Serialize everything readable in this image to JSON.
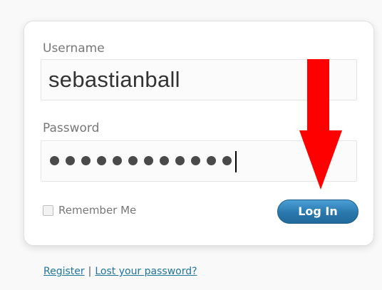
{
  "login_form": {
    "username_label": "Username",
    "username_value": "sebastianball",
    "password_label": "Password",
    "password_mask_count": 12,
    "remember_label": "Remember Me",
    "remember_checked": false,
    "login_button_label": "Log In"
  },
  "footer": {
    "register_link": "Register",
    "separator": "|",
    "lost_password_link": "Lost your password?"
  },
  "colors": {
    "accent_button": "#2a78ad",
    "link": "#21759b",
    "annotation_arrow": "#ff0000"
  },
  "annotation": {
    "arrow_icon": "red-down-arrow-icon"
  }
}
